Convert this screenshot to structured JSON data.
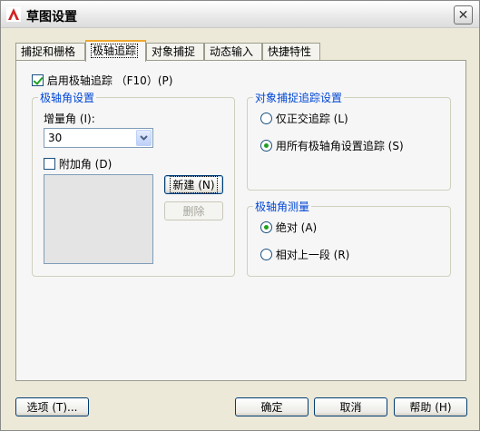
{
  "window": {
    "title": "草图设置",
    "close_glyph": "✕"
  },
  "tabs": [
    {
      "label": "捕捉和栅格"
    },
    {
      "label": "极轴追踪"
    },
    {
      "label": "对象捕捉"
    },
    {
      "label": "动态输入"
    },
    {
      "label": "快捷特性"
    }
  ],
  "polar": {
    "enable_label": "启用极轴追踪 （F10）(P)",
    "enable_checked": true,
    "angle_group": {
      "legend": "极轴角设置",
      "increment_label": "增量角 (I):",
      "increment_value": "30",
      "additional_label": "附加角 (D)",
      "additional_checked": false,
      "new_button": "新建 (N)",
      "delete_button": "删除"
    },
    "snap_group": {
      "legend": "对象捕捉追踪设置",
      "option_orthogonal": "仅正交追踪 (L)",
      "option_all": "用所有极轴角设置追踪 (S)",
      "selected": "all"
    },
    "measure_group": {
      "legend": "极轴角测量",
      "option_absolute": "绝对 (A)",
      "option_relative": "相对上一段 (R)",
      "selected": "absolute"
    }
  },
  "footer": {
    "options_button": "选项 (T)...",
    "ok_button": "确定",
    "cancel_button": "取消",
    "help_button": "帮助 (H)"
  },
  "icons": {
    "app": "autocad-logo-icon",
    "close": "close-icon",
    "dropdown": "chevron-down-icon"
  },
  "colors": {
    "accent_tab": "#f0a830",
    "group_legend": "#0046d5",
    "check": "#21a121"
  }
}
